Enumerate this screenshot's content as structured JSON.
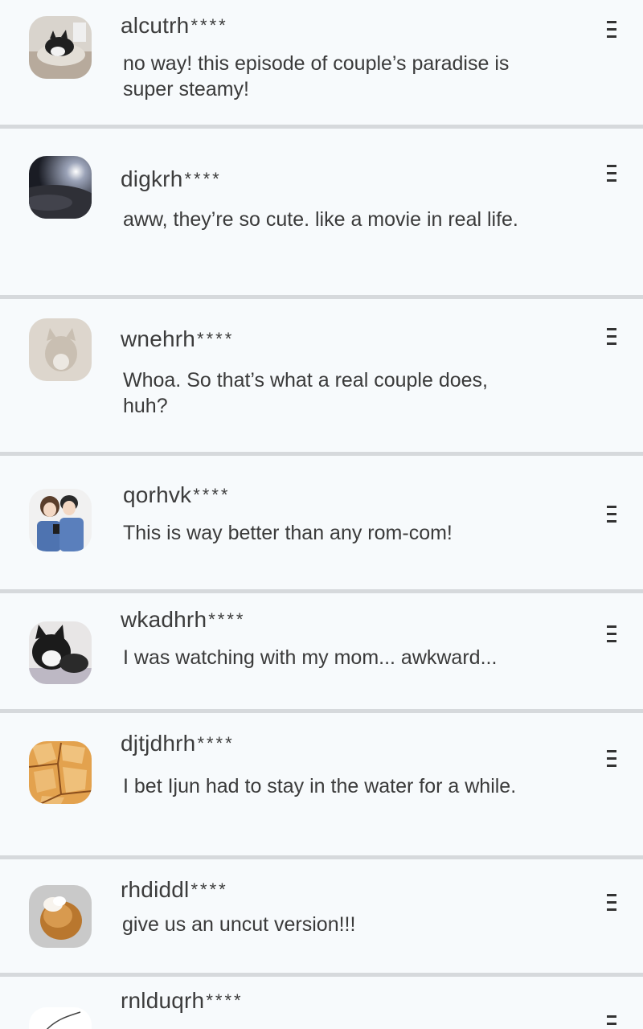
{
  "comments": [
    {
      "user": "alcutrh",
      "mask": "****",
      "text": "no way! this episode of couple’s paradise is super steamy!",
      "avatar": "cat-photo-avatar"
    },
    {
      "user": "digkrh",
      "mask": "****",
      "text": "aww, they’re so cute. like a movie in real life.",
      "avatar": "planet-photo-avatar"
    },
    {
      "user": "wnehrh",
      "mask": "****",
      "text": "Whoa. So that’s what a real couple does, huh?",
      "avatar": "faded-cat-avatar"
    },
    {
      "user": "qorhvk",
      "mask": "****",
      "text": "This is way better than any rom-com!",
      "avatar": "couple-illustration-avatar"
    },
    {
      "user": "wkadhrh",
      "mask": "****",
      "text": "I was watching with my mom... awkward...",
      "avatar": "cat-photo-avatar-2"
    },
    {
      "user": "djtjdhrh",
      "mask": "****",
      "text": "I bet Ijun had to stay in the water for a while.",
      "avatar": "cracked-ground-avatar"
    },
    {
      "user": "rhdiddl",
      "mask": "****",
      "text": "give us an uncut version!!!",
      "avatar": "bread-avatar"
    },
    {
      "user": "rnlduqrh",
      "mask": "****",
      "text": "",
      "avatar": "sketch-avatar"
    }
  ],
  "colors": {
    "background": "#f7fafc",
    "divider": "#d6d9dc",
    "text": "#3a3a3a"
  },
  "icons": {
    "menu": "menu-icon"
  }
}
